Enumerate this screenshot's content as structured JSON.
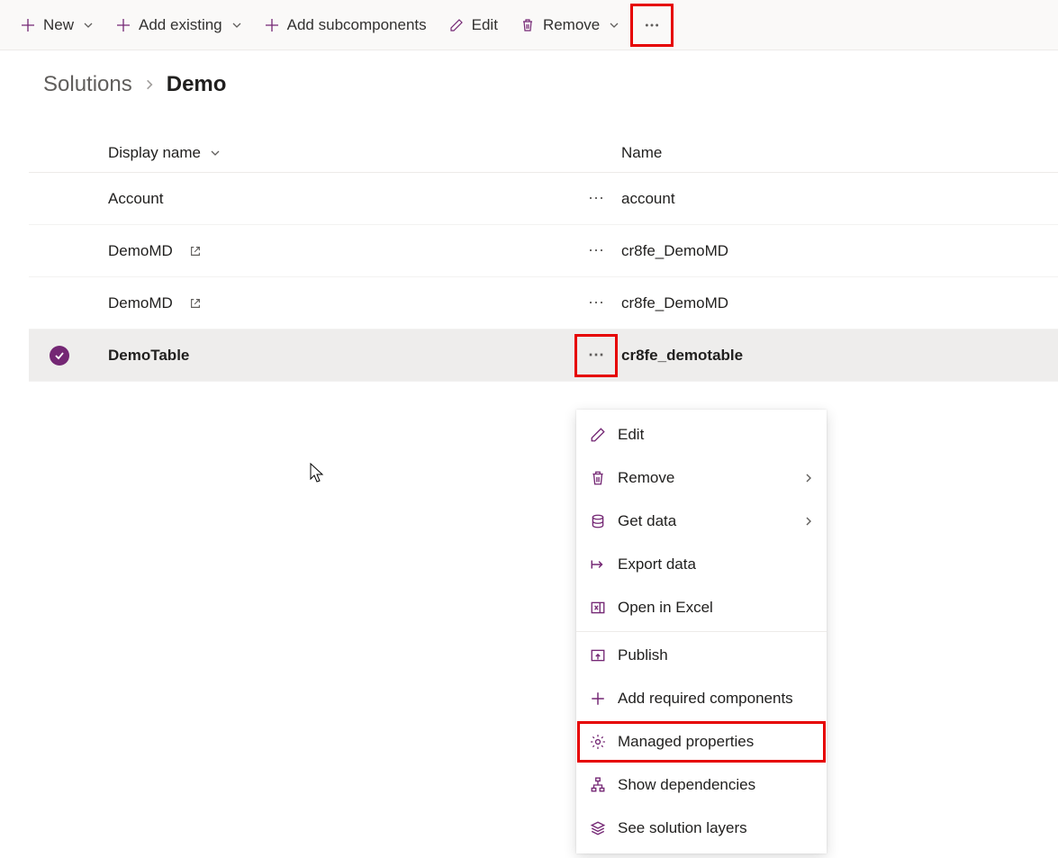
{
  "commandBar": {
    "new": "New",
    "addExisting": "Add existing",
    "addSubcomponents": "Add subcomponents",
    "edit": "Edit",
    "remove": "Remove"
  },
  "breadcrumb": {
    "parent": "Solutions",
    "current": "Demo"
  },
  "columns": {
    "displayName": "Display name",
    "name": "Name"
  },
  "rows": [
    {
      "display": "Account",
      "external": false,
      "name": "account",
      "selected": false
    },
    {
      "display": "DemoMD",
      "external": true,
      "name": "cr8fe_DemoMD",
      "selected": false
    },
    {
      "display": "DemoMD",
      "external": true,
      "name": "cr8fe_DemoMD",
      "selected": false
    },
    {
      "display": "DemoTable",
      "external": false,
      "name": "cr8fe_demotable",
      "selected": true
    }
  ],
  "contextMenu": {
    "edit": "Edit",
    "remove": "Remove",
    "getData": "Get data",
    "exportData": "Export data",
    "openInExcel": "Open in Excel",
    "publish": "Publish",
    "addRequired": "Add required components",
    "managedProps": "Managed properties",
    "showDependencies": "Show dependencies",
    "solutionLayers": "See solution layers"
  }
}
